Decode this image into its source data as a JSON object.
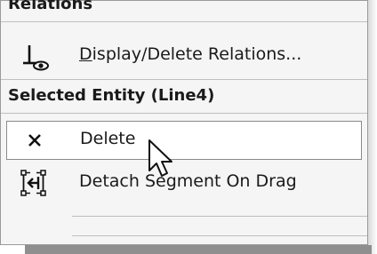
{
  "menu": {
    "section_relations": "Relations",
    "display_delete_label_prefix": "D",
    "display_delete_label_rest": "isplay/Delete Relations...",
    "section_selected": "Selected Entity (Line4)",
    "delete_label": "Delete",
    "detach_label": "Detach Segment On Drag",
    "icons": {
      "display_delete": "relation-eye-icon",
      "delete": "x-delete-icon",
      "detach": "detach-segment-icon"
    }
  },
  "colors": {
    "menu_bg": "#f5f5f5",
    "highlight_bg": "#ffffff",
    "text": "#1a1a1a"
  }
}
